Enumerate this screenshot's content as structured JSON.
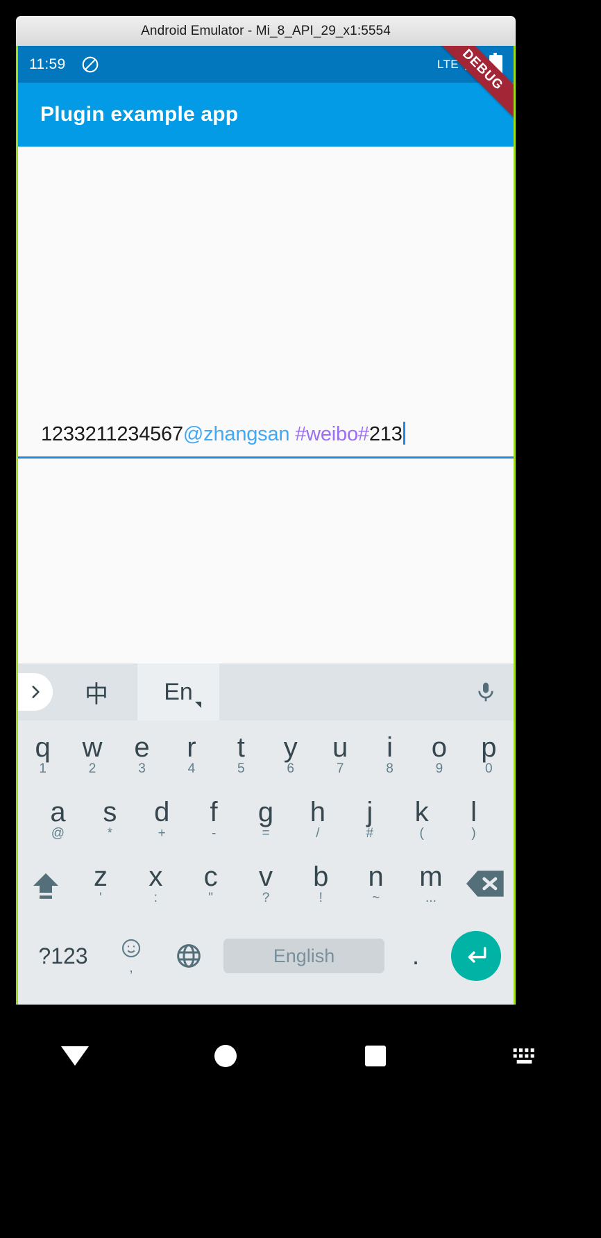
{
  "window": {
    "title": "Android Emulator - Mi_8_API_29_x1:5554"
  },
  "status_bar": {
    "clock": "11:59",
    "dnd_icon": "do-not-disturb-icon",
    "network": "LTE",
    "signal_icon": "signal-triangle-icon",
    "battery_icon": "battery-icon",
    "background_color": "#0277bd"
  },
  "debug_ribbon": {
    "label": "DEBUG",
    "color": "#a32637"
  },
  "app_bar": {
    "title": "Plugin example app",
    "background_color": "#039be5"
  },
  "text_field": {
    "plain_prefix": "1233211234567",
    "mention": "@zhangsan",
    "topic": " #weibo#",
    "plain_suffix": "213",
    "full_value": "1233211234567@zhangsan #weibo#213",
    "mention_color": "#40a9f5",
    "topic_color": "#9b6ef3",
    "underline_color": "#1e88e5",
    "caret_visible": true
  },
  "keyboard": {
    "toolbar": {
      "expand_icon": "chevron-right-icon",
      "language_chinese": "中",
      "language_english": "En",
      "selected_language": "En",
      "mic_icon": "microphone-icon"
    },
    "row1": [
      {
        "main": "q",
        "sub": "1"
      },
      {
        "main": "w",
        "sub": "2"
      },
      {
        "main": "e",
        "sub": "3"
      },
      {
        "main": "r",
        "sub": "4"
      },
      {
        "main": "t",
        "sub": "5"
      },
      {
        "main": "y",
        "sub": "6"
      },
      {
        "main": "u",
        "sub": "7"
      },
      {
        "main": "i",
        "sub": "8"
      },
      {
        "main": "o",
        "sub": "9"
      },
      {
        "main": "p",
        "sub": "0"
      }
    ],
    "row2": [
      {
        "main": "a",
        "sub": "@"
      },
      {
        "main": "s",
        "sub": "*"
      },
      {
        "main": "d",
        "sub": "+"
      },
      {
        "main": "f",
        "sub": "-"
      },
      {
        "main": "g",
        "sub": "="
      },
      {
        "main": "h",
        "sub": "/"
      },
      {
        "main": "j",
        "sub": "#"
      },
      {
        "main": "k",
        "sub": "("
      },
      {
        "main": "l",
        "sub": ")"
      }
    ],
    "row3": [
      {
        "main": "z",
        "sub": "'"
      },
      {
        "main": "x",
        "sub": ":"
      },
      {
        "main": "c",
        "sub": "\""
      },
      {
        "main": "v",
        "sub": "?"
      },
      {
        "main": "b",
        "sub": "!"
      },
      {
        "main": "n",
        "sub": "~"
      },
      {
        "main": "m",
        "sub": "..."
      }
    ],
    "shift_icon": "shift-icon",
    "backspace_icon": "backspace-icon",
    "row4": {
      "symbols_key": "?123",
      "emoji_icon": "emoji-icon",
      "emoji_sub": ",",
      "globe_icon": "globe-icon",
      "space_label": "English",
      "period_key": ".",
      "enter_icon": "enter-icon",
      "enter_color": "#00b3a4"
    }
  },
  "nav_bar": {
    "back_icon": "back-triangle-icon",
    "home_icon": "home-circle-icon",
    "recents_icon": "recents-square-icon",
    "keyboard_icon": "keyboard-icon"
  }
}
